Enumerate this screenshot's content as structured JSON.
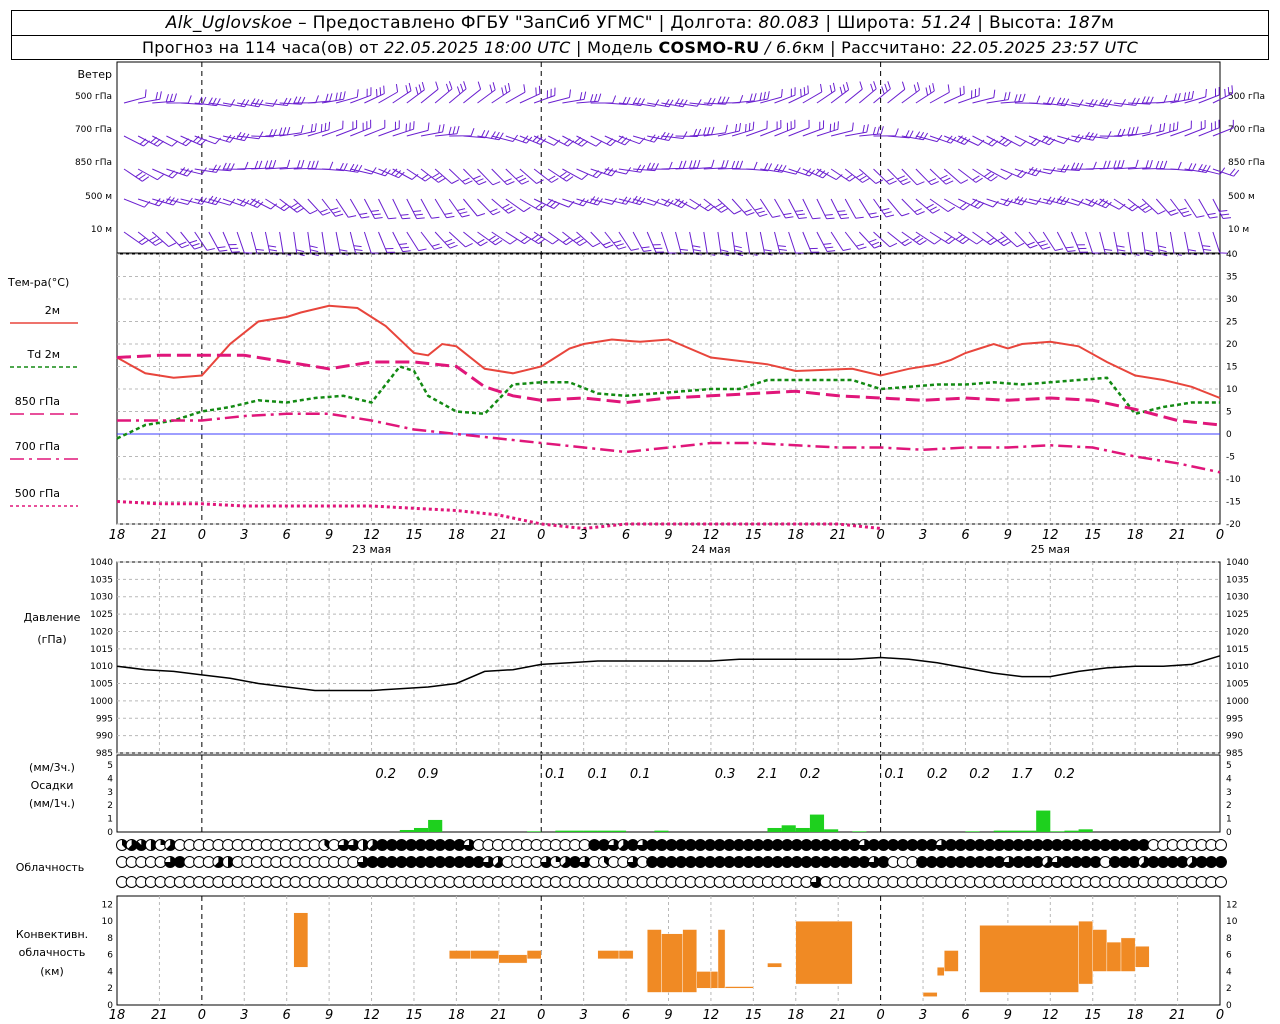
{
  "header": {
    "station": "Alk_Uglovskoe",
    "provider": "– Предоставлено ФГБУ \"ЗапСиб УГМС\"",
    "lon_label": "Долгота:",
    "lon": "80.083",
    "lat_label": "Широта:",
    "lat": "51.24",
    "alt_label": "Высота:",
    "alt": "187",
    "alt_unit": "м",
    "forecast_prefix": "Прогноз на 114 часа(ов) от",
    "forecast_start": "22.05.2025 18:00 UTC",
    "model_label": "| Модель",
    "model": "COSMO-RU",
    "model_res": "/ 6.6",
    "model_res_unit": "км",
    "computed_label": "| Рассчитано:",
    "computed": "22.05.2025 23:57 UTC"
  },
  "x_axis": {
    "hour_labels": [
      "18",
      "21",
      "0",
      "3",
      "6",
      "9",
      "12",
      "15",
      "18",
      "21",
      "0",
      "3",
      "6",
      "9",
      "12",
      "15",
      "18",
      "21",
      "0",
      "3",
      "6",
      "9",
      "12",
      "15",
      "18",
      "21",
      "0"
    ],
    "day_labels": [
      {
        "hour": 18,
        "text": "23 мая"
      },
      {
        "hour": 42,
        "text": "24 мая"
      },
      {
        "hour": 66,
        "text": "25 мая"
      }
    ],
    "midnights": [
      6,
      30,
      54,
      78
    ]
  },
  "wind": {
    "title": "Ветер",
    "levels_left": [
      "500 гПа",
      "700 гПа",
      "850 гПа",
      "500  м",
      "10   м"
    ],
    "levels_right": [
      "500 гПа",
      "700 гПа",
      "850 гПа",
      "500 м",
      "10 м"
    ],
    "color": "#6a1fd0"
  },
  "temp_panel": {
    "title": "Тем-ра(°C)",
    "legend": [
      {
        "label": "2м",
        "color": "#e8453c",
        "dash": ""
      },
      {
        "label": "Td  2м",
        "color": "#138a13",
        "dash": "4,3"
      },
      {
        "label": "850 гПа",
        "color": "#e0167a",
        "dash": "14,6"
      },
      {
        "label": "700 гПа",
        "color": "#e0167a",
        "dash": "14,5,3,5"
      },
      {
        "label": "500 гПа",
        "color": "#e0167a",
        "dash": "3,3"
      }
    ],
    "ticks": [
      "40",
      "35",
      "30",
      "25",
      "20",
      "15",
      "10",
      "5",
      "0",
      "-5",
      "-10",
      "-15",
      "-20"
    ]
  },
  "pressure_panel": {
    "title": "Давление",
    "unit": "(гПа)",
    "ticks": [
      "1040",
      "1035",
      "1030",
      "1025",
      "1020",
      "1015",
      "1010",
      "1005",
      "1000",
      "995",
      "990",
      "985"
    ]
  },
  "precip_panel": {
    "unit3h": "(мм/3ч.)",
    "title": "Осадки",
    "unit1h": "(мм/1ч.)",
    "ticks": [
      "5",
      "4",
      "3",
      "2",
      "1",
      "0"
    ],
    "totals": [
      {
        "hour": 19,
        "text": "0.2"
      },
      {
        "hour": 22,
        "text": "0.9"
      },
      {
        "hour": 31,
        "text": "0.1"
      },
      {
        "hour": 34,
        "text": "0.1"
      },
      {
        "hour": 37,
        "text": "0.1"
      },
      {
        "hour": 43,
        "text": "0.3"
      },
      {
        "hour": 46,
        "text": "2.1"
      },
      {
        "hour": 49,
        "text": "0.2"
      },
      {
        "hour": 55,
        "text": "0.1"
      },
      {
        "hour": 58,
        "text": "0.2"
      },
      {
        "hour": 61,
        "text": "0.2"
      },
      {
        "hour": 64,
        "text": "1.7"
      },
      {
        "hour": 67,
        "text": "0.2"
      }
    ]
  },
  "cloud_panel": {
    "title": "Облачность"
  },
  "conv_panel": {
    "title1": "Конвективн.",
    "title2": "облачность",
    "unit": "(км)",
    "ticks": [
      "12",
      "10",
      "8",
      "6",
      "4",
      "2",
      "0"
    ]
  },
  "chart_data": [
    {
      "type": "line",
      "name": "temperature",
      "x_unit": "hours from 22.05.2025 18:00 UTC",
      "xlim": [
        0,
        78
      ],
      "ylim": [
        -20,
        40
      ],
      "series": [
        {
          "name": "2м",
          "color": "#e8453c",
          "x": [
            0,
            2,
            4,
            6,
            8,
            10,
            12,
            13,
            15,
            17,
            19,
            21,
            22,
            23,
            24,
            26,
            28,
            30,
            31,
            32,
            33,
            35,
            37,
            39,
            42,
            46,
            48,
            52,
            54,
            56,
            58,
            59,
            60,
            61,
            62,
            63,
            64,
            66,
            68,
            70,
            72,
            74,
            76,
            78
          ],
          "y": [
            17,
            13.5,
            12.5,
            13,
            20,
            25,
            26,
            27,
            28.5,
            28,
            24,
            18,
            17.5,
            20,
            19.5,
            14.5,
            13.5,
            15,
            17,
            19,
            20,
            21,
            20.5,
            21,
            17,
            15.5,
            14,
            14.5,
            13,
            14.5,
            15.5,
            16.5,
            18,
            19,
            20,
            19,
            20,
            20.5,
            19.5,
            16,
            13,
            12,
            10.5,
            8
          ]
        },
        {
          "name": "Td  2м",
          "color": "#138a13",
          "x": [
            0,
            2,
            4,
            6,
            8,
            10,
            12,
            14,
            16,
            18,
            19,
            20,
            21,
            22,
            24,
            26,
            28,
            30,
            32,
            34,
            36,
            38,
            40,
            42,
            44,
            46,
            48,
            50,
            52,
            54,
            56,
            58,
            60,
            62,
            64,
            66,
            68,
            70,
            72,
            74,
            76,
            78
          ],
          "y": [
            -1,
            2,
            3,
            5,
            6,
            7.5,
            7,
            8,
            8.5,
            7,
            11,
            15,
            14,
            8.5,
            5,
            4.5,
            11,
            11.5,
            11.5,
            9,
            8.5,
            9,
            9.5,
            10,
            10,
            12,
            12,
            12,
            12,
            10,
            10.5,
            11,
            11,
            11.5,
            11,
            11.5,
            12,
            12.5,
            4.5,
            6,
            7,
            7
          ]
        },
        {
          "name": "850 гПа",
          "color": "#e0167a",
          "x": [
            0,
            3,
            6,
            9,
            12,
            15,
            18,
            21,
            24,
            26,
            28,
            30,
            33,
            36,
            39,
            42,
            45,
            48,
            51,
            54,
            57,
            60,
            63,
            66,
            69,
            72,
            75,
            78
          ],
          "y": [
            17,
            17.5,
            17.5,
            17.5,
            16,
            14.5,
            16,
            16,
            15,
            10.5,
            8.5,
            7.5,
            8,
            7,
            8,
            8.5,
            9,
            9.5,
            8.5,
            8,
            7.5,
            8,
            7.5,
            8,
            7.5,
            5.5,
            3,
            2
          ]
        },
        {
          "name": "700 гПа",
          "color": "#e0167a",
          "x": [
            0,
            3,
            6,
            9,
            12,
            15,
            18,
            21,
            24,
            27,
            30,
            33,
            36,
            39,
            42,
            45,
            48,
            51,
            54,
            57,
            60,
            63,
            66,
            69,
            72,
            75,
            78
          ],
          "y": [
            3,
            3,
            3,
            4,
            4.5,
            4.5,
            3,
            1,
            0,
            -1,
            -2,
            -3,
            -4,
            -3,
            -2,
            -2,
            -2.5,
            -3,
            -3,
            -3.5,
            -3,
            -3,
            -2.5,
            -3,
            -5,
            -6.5,
            -8.5
          ]
        },
        {
          "name": "500 гПа",
          "color": "#e0167a",
          "x": [
            0,
            3,
            6,
            9,
            12,
            15,
            18,
            21,
            24,
            27,
            30,
            33,
            36,
            39,
            42,
            45,
            48,
            51,
            54
          ],
          "y": [
            -15,
            -15.5,
            -15.5,
            -16,
            -16,
            -16,
            -16,
            -16.5,
            -17,
            -18,
            -20,
            -21,
            -20,
            -20,
            -20,
            -20,
            -20,
            -20,
            -21
          ]
        }
      ]
    },
    {
      "type": "line",
      "name": "pressure",
      "xlim": [
        0,
        78
      ],
      "ylim": [
        985,
        1040
      ],
      "series": [
        {
          "name": "Давление",
          "color": "#000000",
          "x": [
            0,
            2,
            4,
            6,
            8,
            10,
            12,
            14,
            16,
            18,
            20,
            22,
            24,
            26,
            28,
            30,
            32,
            34,
            36,
            38,
            40,
            42,
            44,
            46,
            48,
            50,
            52,
            54,
            56,
            58,
            60,
            62,
            64,
            66,
            68,
            70,
            72,
            74,
            76,
            78
          ],
          "y": [
            1010,
            1009,
            1008.5,
            1007.5,
            1006.5,
            1005,
            1004,
            1003,
            1003,
            1003,
            1003.5,
            1004,
            1005,
            1008.5,
            1009,
            1010.5,
            1011,
            1011.5,
            1011.5,
            1011.5,
            1011.5,
            1011.5,
            1012,
            1012,
            1012,
            1012,
            1012,
            1012.5,
            1012,
            1011,
            1009.5,
            1008,
            1007,
            1007,
            1008.5,
            1009.5,
            1010,
            1010,
            1010.5,
            1013
          ]
        }
      ]
    },
    {
      "type": "bar",
      "name": "precipitation_1h",
      "xlim": [
        0,
        78
      ],
      "ylim": [
        0,
        5
      ],
      "color": "#1ed01e",
      "x": [
        20,
        21,
        22,
        29,
        31,
        32,
        33,
        34,
        35,
        38,
        46,
        47,
        48,
        49,
        50,
        52,
        60,
        62,
        63,
        64,
        65,
        66,
        67,
        68
      ],
      "y": [
        0.15,
        0.3,
        0.9,
        0.05,
        0.1,
        0.1,
        0.1,
        0.1,
        0.1,
        0.1,
        0.3,
        0.5,
        0.3,
        1.3,
        0.2,
        0.05,
        0.05,
        0.1,
        0.1,
        0.1,
        1.6,
        0.05,
        0.1,
        0.2
      ]
    },
    {
      "type": "table",
      "name": "cloudiness_eighths",
      "rows_description": [
        "upper",
        "middle",
        "lower"
      ],
      "upper": [
        3,
        5,
        7,
        4,
        2,
        5,
        0,
        0,
        0,
        0,
        0,
        0,
        0,
        0,
        0,
        0,
        0,
        0,
        0,
        0,
        0,
        3,
        0,
        6,
        6,
        4,
        5,
        8,
        8,
        8,
        8,
        8,
        8,
        8,
        8,
        8,
        6,
        0,
        0,
        0,
        0,
        0,
        0,
        0,
        0,
        0,
        0,
        0,
        0,
        8,
        8,
        6,
        5,
        8,
        6,
        8,
        8,
        8,
        8,
        8,
        8,
        8,
        8,
        8,
        8,
        8,
        8,
        8,
        8,
        8,
        8,
        8,
        8,
        8,
        8,
        8,
        8,
        6,
        8,
        8,
        8,
        8,
        8,
        8,
        8,
        6,
        8,
        8,
        8,
        8,
        8,
        8,
        8,
        8,
        8,
        8,
        8,
        8,
        8,
        8,
        8,
        8,
        8,
        8,
        8,
        8,
        8,
        0,
        0,
        0,
        0,
        0,
        0,
        0,
        0,
        0,
        0,
        0
      ],
      "middle": [
        0,
        0,
        0,
        0,
        0,
        6,
        8,
        0,
        0,
        0,
        5,
        4,
        0,
        0,
        0,
        0,
        0,
        0,
        0,
        0,
        0,
        0,
        0,
        0,
        0,
        6,
        8,
        8,
        8,
        8,
        8,
        8,
        8,
        8,
        8,
        8,
        8,
        8,
        6,
        5,
        0,
        0,
        0,
        0,
        6,
        2,
        5,
        8,
        6,
        0,
        3,
        0,
        0,
        6,
        0,
        8,
        8,
        8,
        8,
        8,
        8,
        8,
        8,
        8,
        8,
        8,
        8,
        8,
        8,
        8,
        8,
        8,
        8,
        8,
        8,
        8,
        8,
        8,
        6,
        8,
        0,
        0,
        0,
        8,
        8,
        8,
        8,
        8,
        8,
        8,
        8,
        8,
        6,
        8,
        8,
        8,
        5,
        6,
        8,
        8,
        8,
        8,
        0,
        8,
        8,
        8,
        5,
        8,
        8,
        8,
        8,
        5,
        8,
        8,
        8,
        0,
        0
      ],
      "lower": [
        0,
        0,
        0,
        0,
        0,
        0,
        0,
        0,
        0,
        0,
        0,
        0,
        0,
        0,
        0,
        0,
        0,
        0,
        0,
        0,
        0,
        0,
        0,
        0,
        0,
        0,
        0,
        0,
        0,
        0,
        0,
        0,
        0,
        0,
        0,
        0,
        0,
        0,
        0,
        0,
        0,
        0,
        0,
        0,
        0,
        0,
        0,
        0,
        0,
        0,
        0,
        0,
        0,
        0,
        0,
        0,
        0,
        0,
        0,
        0,
        0,
        0,
        0,
        0,
        0,
        0,
        0,
        0,
        0,
        0,
        0,
        0,
        6,
        0,
        0,
        0,
        0,
        0,
        0,
        0,
        0,
        0,
        0,
        0,
        0,
        0,
        0,
        0,
        0,
        0,
        0,
        0,
        0,
        0,
        0,
        0,
        0,
        0,
        0,
        0,
        0,
        0,
        0,
        0,
        0,
        0,
        0,
        0,
        0,
        0,
        0,
        0,
        0,
        0,
        0,
        0,
        0
      ]
    },
    {
      "type": "bar",
      "name": "convective_cloud_km",
      "xlim": [
        0,
        78
      ],
      "ylim": [
        0,
        13
      ],
      "color": "#f08a24",
      "intervals": [
        {
          "x0": 12.5,
          "x1": 13.5,
          "bottom": 4.5,
          "top": 11
        },
        {
          "x0": 23.5,
          "x1": 25,
          "bottom": 5.5,
          "top": 6.5
        },
        {
          "x0": 25,
          "x1": 27,
          "bottom": 5.5,
          "top": 6.5
        },
        {
          "x0": 27,
          "x1": 29,
          "bottom": 5,
          "top": 6
        },
        {
          "x0": 29,
          "x1": 30,
          "bottom": 5.5,
          "top": 6.5
        },
        {
          "x0": 34,
          "x1": 35.5,
          "bottom": 5.5,
          "top": 6.5
        },
        {
          "x0": 35.5,
          "x1": 36.5,
          "bottom": 5.5,
          "top": 6.5
        },
        {
          "x0": 37.5,
          "x1": 38.5,
          "bottom": 1.5,
          "top": 9
        },
        {
          "x0": 38.5,
          "x1": 40,
          "bottom": 1.5,
          "top": 8.5
        },
        {
          "x0": 40,
          "x1": 41,
          "bottom": 1.5,
          "top": 9
        },
        {
          "x0": 41,
          "x1": 42,
          "bottom": 2,
          "top": 4
        },
        {
          "x0": 42,
          "x1": 42.5,
          "bottom": 2,
          "top": 4
        },
        {
          "x0": 42.5,
          "x1": 43,
          "bottom": 2,
          "top": 9
        },
        {
          "x0": 43,
          "x1": 45,
          "bottom": 2,
          "top": 2.2
        },
        {
          "x0": 46,
          "x1": 47,
          "bottom": 4.5,
          "top": 5
        },
        {
          "x0": 48,
          "x1": 52,
          "bottom": 2.5,
          "top": 10
        },
        {
          "x0": 57,
          "x1": 58,
          "bottom": 1,
          "top": 1.5
        },
        {
          "x0": 58,
          "x1": 58.5,
          "bottom": 3.5,
          "top": 4.5
        },
        {
          "x0": 58.5,
          "x1": 59.5,
          "bottom": 4,
          "top": 6.5
        },
        {
          "x0": 61,
          "x1": 68,
          "bottom": 1.5,
          "top": 9.5
        },
        {
          "x0": 68,
          "x1": 69,
          "bottom": 2.5,
          "top": 10
        },
        {
          "x0": 69,
          "x1": 70,
          "bottom": 4,
          "top": 9
        },
        {
          "x0": 70,
          "x1": 71,
          "bottom": 4,
          "top": 7.5
        },
        {
          "x0": 71,
          "x1": 72,
          "bottom": 4,
          "top": 8
        },
        {
          "x0": 72,
          "x1": 73,
          "bottom": 4.5,
          "top": 7
        }
      ]
    }
  ]
}
